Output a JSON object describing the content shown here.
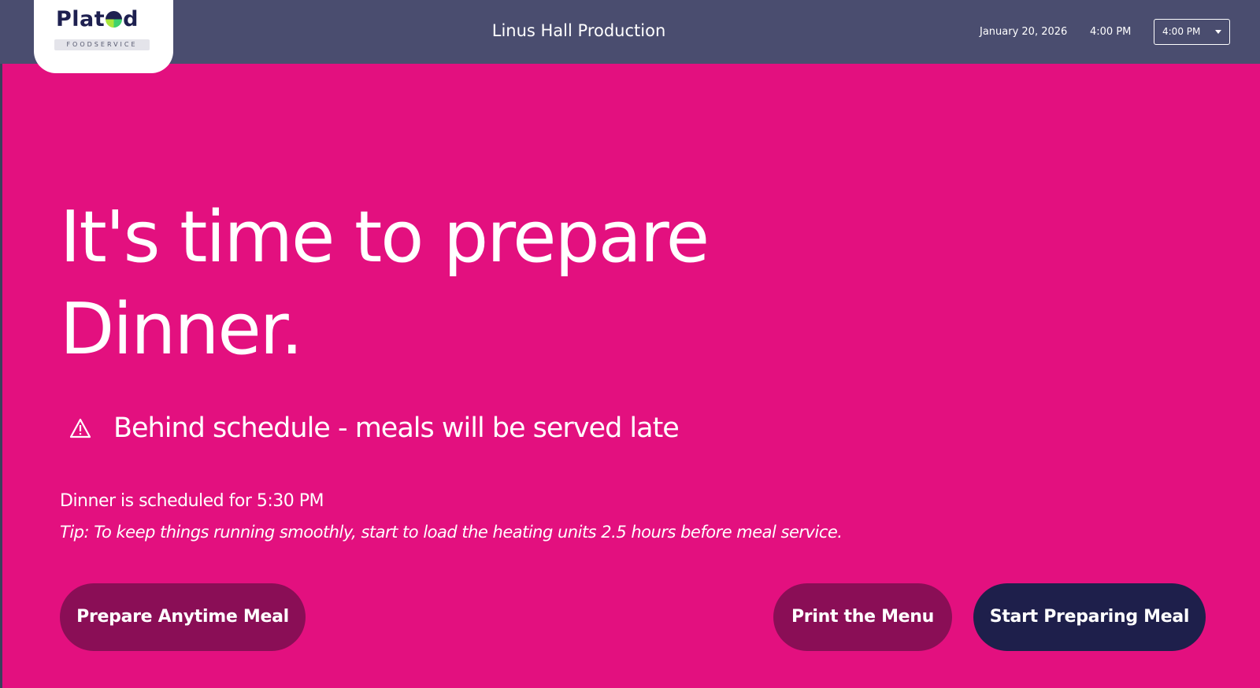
{
  "header": {
    "logo_text": "Plated",
    "logo_subtitle": "FOODSERVICE",
    "title": "Linus Hall Production",
    "date": "January 20, 2026",
    "time": "4:00 PM",
    "time_select": {
      "selected": "4:00 PM"
    }
  },
  "main": {
    "headline_line1": "It's time to prepare",
    "headline_line2": "Dinner.",
    "warning": {
      "icon": "warning-triangle-icon",
      "text": "Behind schedule - meals will be served late"
    },
    "schedule_text": "Dinner is scheduled for 5:30 PM",
    "tip_text": "Tip: To keep things running smoothly, start to load the heating units 2.5 hours before meal service."
  },
  "actions": {
    "anytime_label": "Prepare Anytime Meal",
    "print_label": "Print the Menu",
    "start_label": "Start Preparing Meal"
  },
  "colors": {
    "background": "#e3107f",
    "topbar": "#4a4d6f",
    "secondary_button": "#8a0e56",
    "primary_button": "#1e1f4b"
  }
}
